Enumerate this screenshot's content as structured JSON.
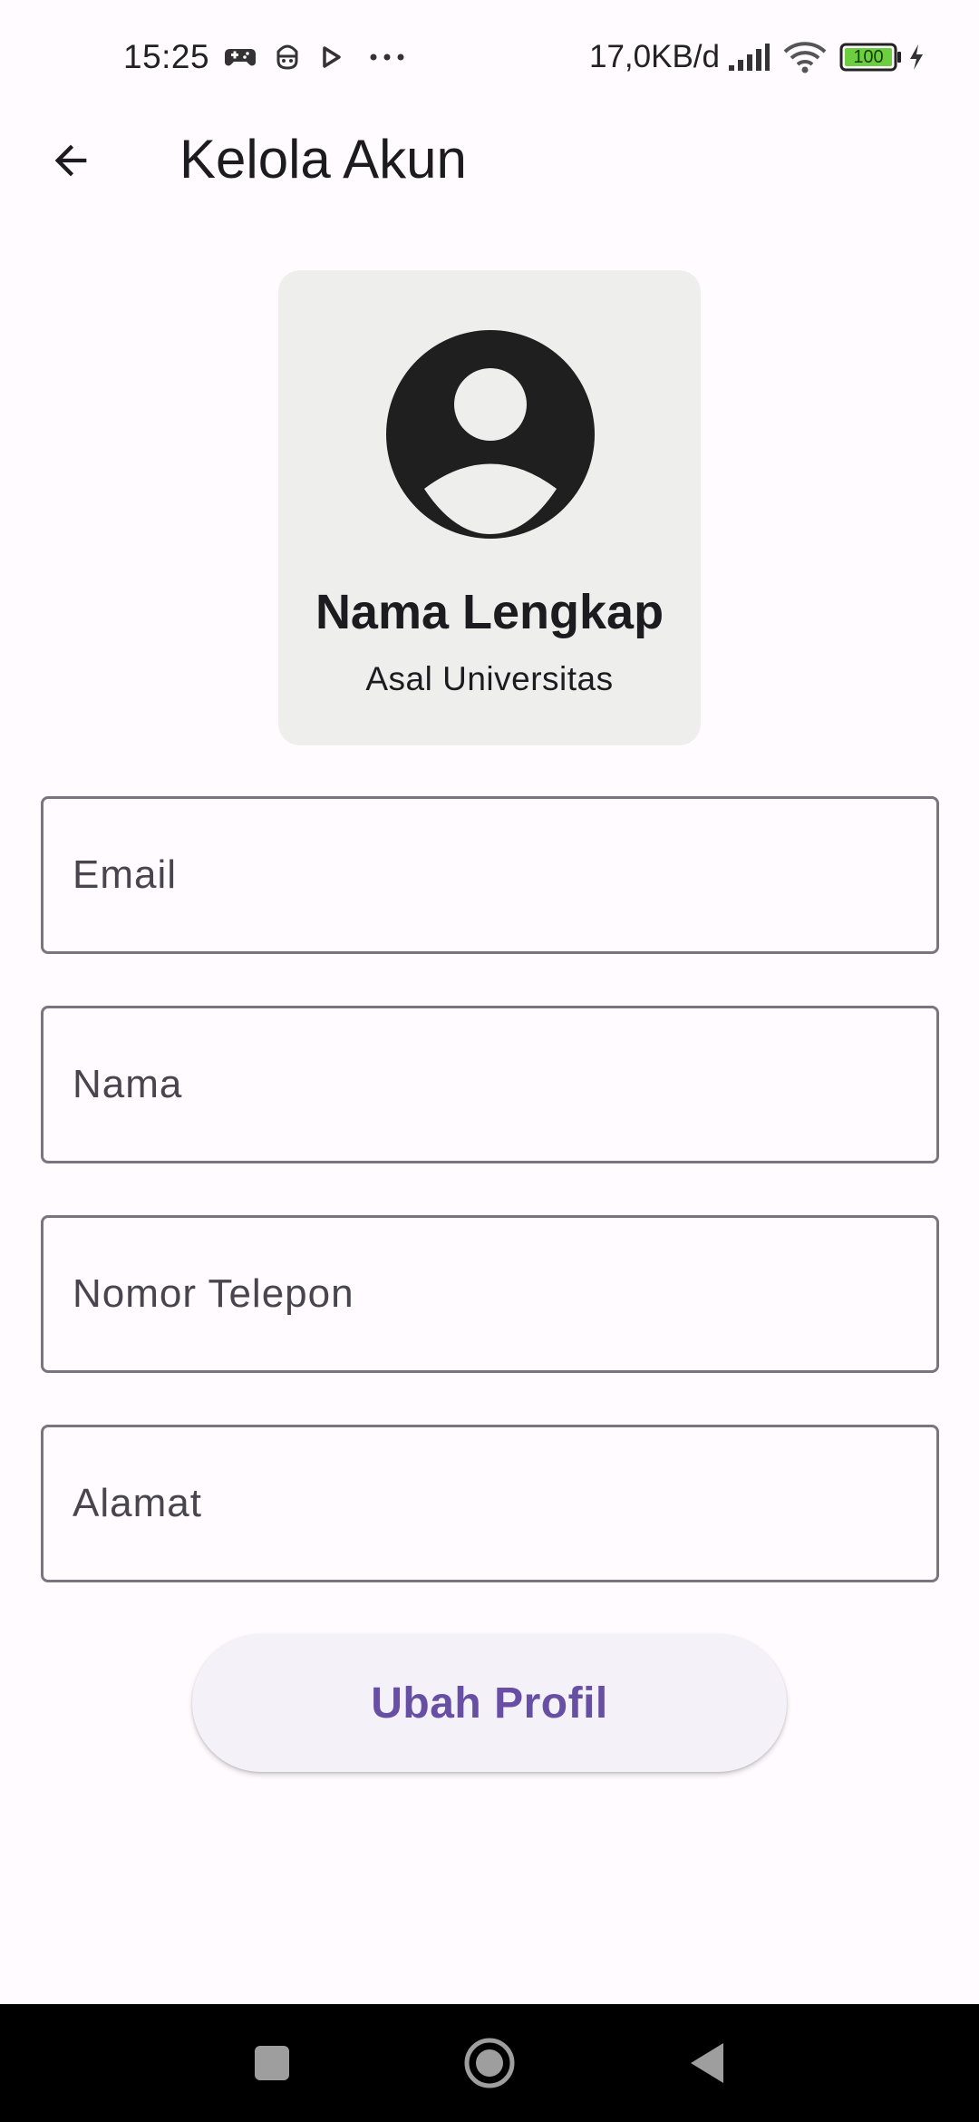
{
  "status_bar": {
    "time": "15:25",
    "net_speed": "17,0KB/d",
    "battery": "100",
    "icons": [
      "game-controller-icon",
      "face-icon",
      "play-icon",
      "more-dots-icon",
      "signal-icon",
      "wifi-icon",
      "battery-icon",
      "charging-icon"
    ]
  },
  "app_bar": {
    "title": "Kelola Akun",
    "back_icon": "arrow-back-icon"
  },
  "profile": {
    "name": "Nama Lengkap",
    "university": "Asal Universitas",
    "avatar_icon": "account-circle-icon"
  },
  "form": {
    "email_placeholder": "Email",
    "name_placeholder": "Nama",
    "phone_placeholder": "Nomor Telepon",
    "address_placeholder": "Alamat",
    "submit_label": "Ubah Profil"
  },
  "nav": {
    "icons": [
      "recent-apps-icon",
      "home-icon",
      "back-icon"
    ]
  },
  "colors": {
    "accent": "#6750a4",
    "card_bg": "#eeefed",
    "page_bg": "#fffbfe",
    "battery_fill": "#6ccf3f"
  }
}
